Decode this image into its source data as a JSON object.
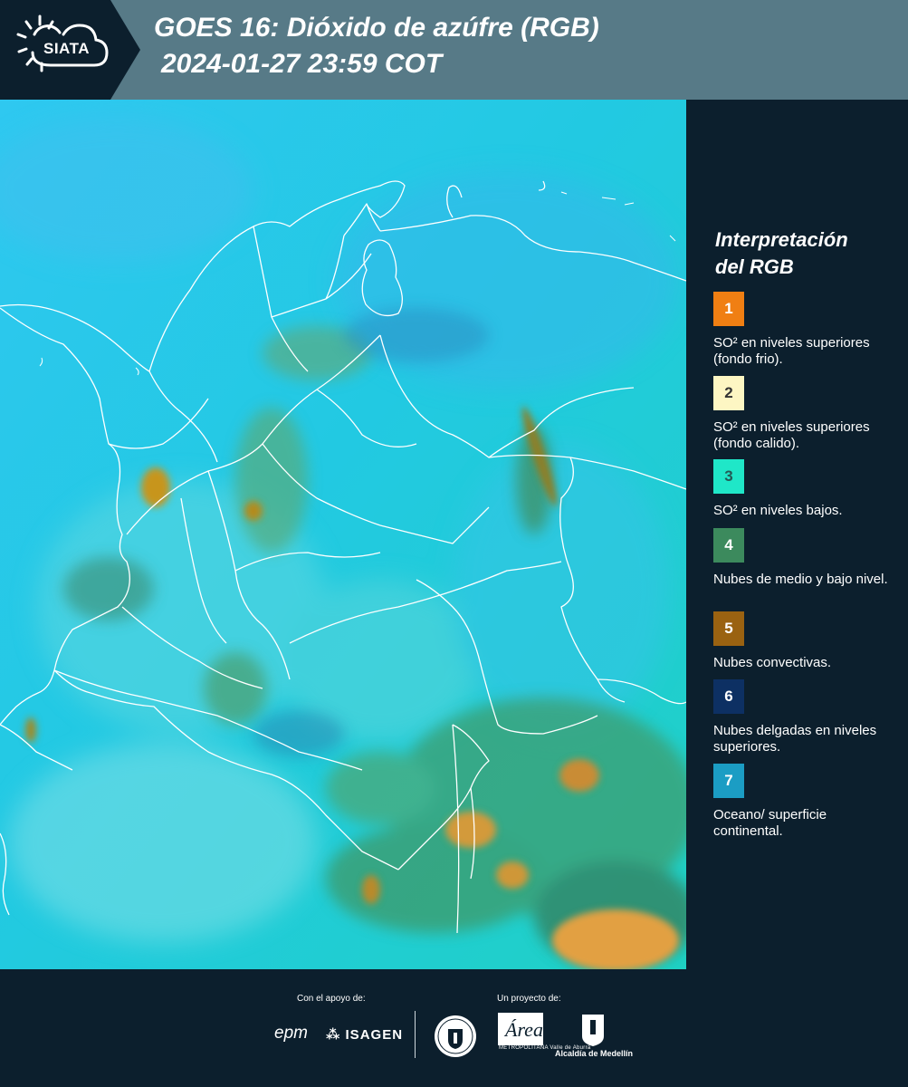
{
  "header": {
    "logo_text": "SIATA",
    "title_line1": "GOES 16: Dióxido de azúfre (RGB)",
    "title_line2": "2024-01-27 23:59 COT"
  },
  "legend": {
    "title_line1": "Interpretación",
    "title_line2": "del RGB",
    "items": [
      {
        "number": "1",
        "color": "#f07f13",
        "text_color": "#ffffff",
        "label": "SO² en niveles superiores (fondo frio)."
      },
      {
        "number": "2",
        "color": "#fdf6c3",
        "text_color": "#333333",
        "label": "SO² en niveles superiores (fondo calido)."
      },
      {
        "number": "3",
        "color": "#1fe7c8",
        "text_color": "#245a55",
        "label": "SO² en niveles bajos."
      },
      {
        "number": "4",
        "color": "#3c8a5d",
        "text_color": "#ffffff",
        "label": "Nubes de medio y bajo nivel."
      },
      {
        "number": "5",
        "color": "#9a6211",
        "text_color": "#ffffff",
        "label": "Nubes convectivas."
      },
      {
        "number": "6",
        "color": "#0d3063",
        "text_color": "#ffffff",
        "label": "Nubes delgadas en niveles superiores."
      },
      {
        "number": "7",
        "color": "#1b9dc4",
        "text_color": "#ffffff",
        "label": "Oceano/ superficie continental."
      }
    ]
  },
  "footer": {
    "support_label": "Con el apoyo de:",
    "project_label": "Un proyecto de:",
    "epm": "epm",
    "isagen": "ISAGEN",
    "area_name": "Área",
    "area_sub": "METROPOLITANA Valle de Aburrá",
    "alcaldia": "Alcaldía de Medellín"
  }
}
